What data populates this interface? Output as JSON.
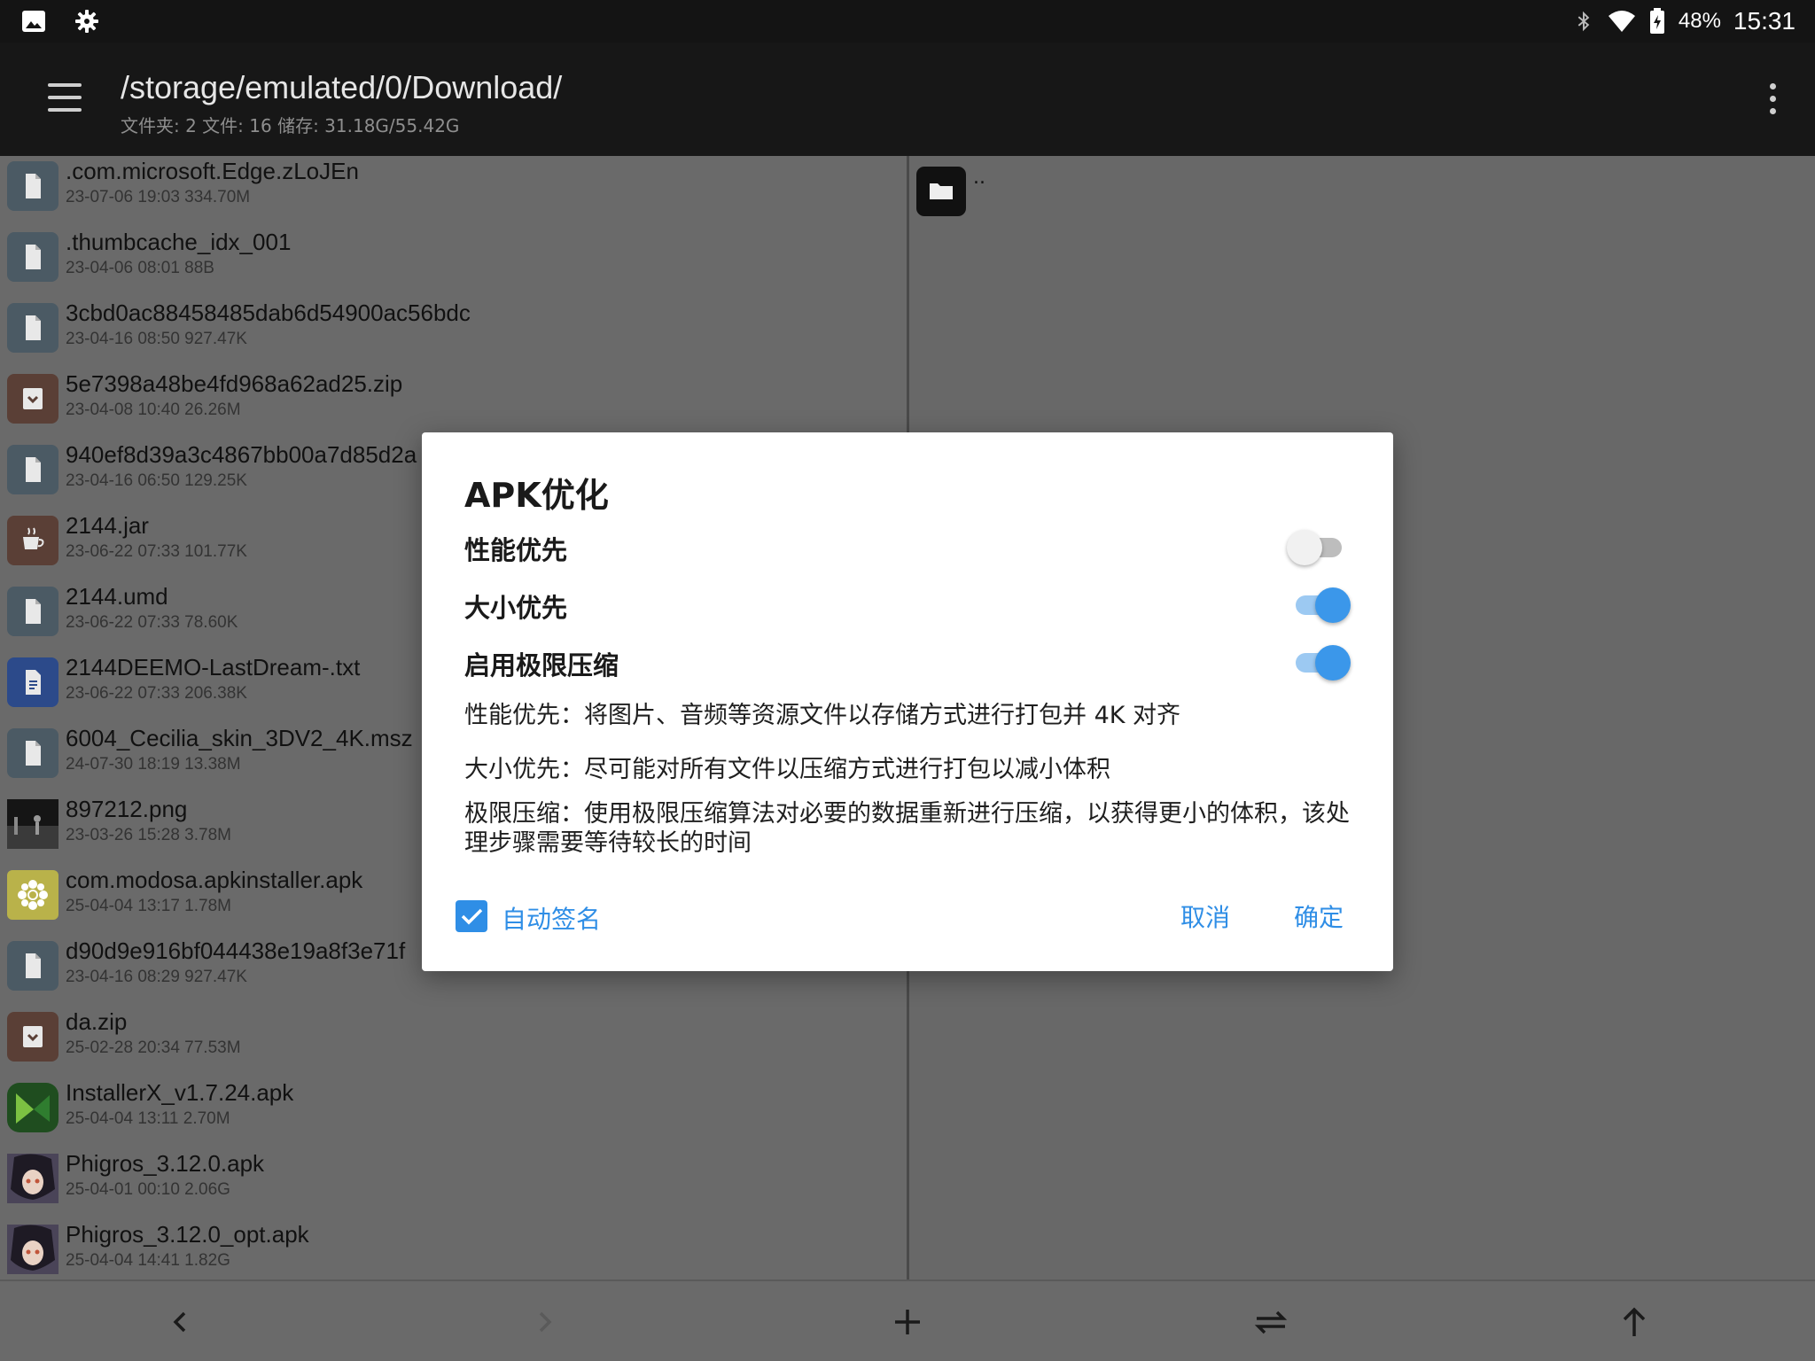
{
  "status_bar": {
    "icons": [
      "image-icon",
      "settings-icon"
    ],
    "battery": "48%",
    "time": "15:31"
  },
  "toolbar": {
    "path": "/storage/emulated/0/Download/",
    "summary": "文件夹: 2  文件: 16  储存: 31.18G/55.42G"
  },
  "files": [
    {
      "name": ".com.microsoft.Edge.zLoJEn",
      "meta": "23-07-06 19:03  334.70M",
      "icon": "file-icon"
    },
    {
      "name": ".thumbcache_idx_001",
      "meta": "23-04-06 08:01  88B",
      "icon": "file-icon"
    },
    {
      "name": "3cbd0ac88458485dab6d54900ac56bdc",
      "meta": "23-04-16 08:50  927.47K",
      "icon": "file-icon"
    },
    {
      "name": "5e7398a48be4fd968a62ad25.zip",
      "meta": "23-04-08 10:40  26.26M",
      "icon": "archive-icon"
    },
    {
      "name": "940ef8d39a3c4867bb00a7d85d2a",
      "meta": "23-04-16 06:50  129.25K",
      "icon": "file-icon"
    },
    {
      "name": "2144.jar",
      "meta": "23-06-22 07:33  101.77K",
      "icon": "jar-icon"
    },
    {
      "name": "2144.umd",
      "meta": "23-06-22 07:33  78.60K",
      "icon": "file-icon"
    },
    {
      "name": "2144DEEMO-LastDream-.txt",
      "meta": "23-06-22 07:33  206.38K",
      "icon": "text-file-icon"
    },
    {
      "name": "6004_Cecilia_skin_3DV2_4K.msz",
      "meta": "24-07-30 18:19  13.38M",
      "icon": "file-icon"
    },
    {
      "name": "897212.png",
      "meta": "23-03-26 15:28  3.78M",
      "icon": "image-thumbnail"
    },
    {
      "name": "com.modosa.apkinstaller.apk",
      "meta": "25-04-04 13:17  1.78M",
      "icon": "apk-flower-icon"
    },
    {
      "name": "d90d9e916bf044438e19a8f3e71f",
      "meta": "23-04-16 08:29  927.47K",
      "icon": "file-icon"
    },
    {
      "name": "da.zip",
      "meta": "25-02-28 20:34  77.53M",
      "icon": "archive-icon"
    },
    {
      "name": "InstallerX_v1.7.24.apk",
      "meta": "25-04-04 13:11  2.70M",
      "icon": "apk-installerx-icon"
    },
    {
      "name": "Phigros_3.12.0.apk",
      "meta": "25-04-01 00:10  2.06G",
      "icon": "apk-phigros-icon"
    },
    {
      "name": "Phigros_3.12.0_opt.apk",
      "meta": "25-04-04 14:41  1.82G",
      "icon": "apk-phigros-icon"
    }
  ],
  "right_pane": {
    "parent_label": ".."
  },
  "bottom_bar": {
    "buttons": [
      "back-arrow-icon",
      "forward-arrow-icon",
      "add-icon",
      "swap-icon",
      "up-arrow-icon"
    ]
  },
  "dialog": {
    "title": "APK优化",
    "options": [
      {
        "label": "性能优先",
        "on": false
      },
      {
        "label": "大小优先",
        "on": true
      },
      {
        "label": "启用极限压缩",
        "on": true
      }
    ],
    "desc_performance": "性能优先：将图片、音频等资源文件以存储方式进行打包并 4K 对齐",
    "desc_size": "大小优先：尽可能对所有文件以压缩方式进行打包以减小体积",
    "desc_extreme": "极限压缩：使用极限压缩算法对必要的数据重新进行压缩，以获得更小的体积，该处理步骤需要等待较长的时间",
    "auto_sign_label": "自动签名",
    "auto_sign_checked": true,
    "cancel_label": "取消",
    "ok_label": "确定"
  },
  "colors": {
    "accent": "#2f8ee6",
    "switch_on": "#3b97ea",
    "toolbar_bg": "#171717"
  }
}
